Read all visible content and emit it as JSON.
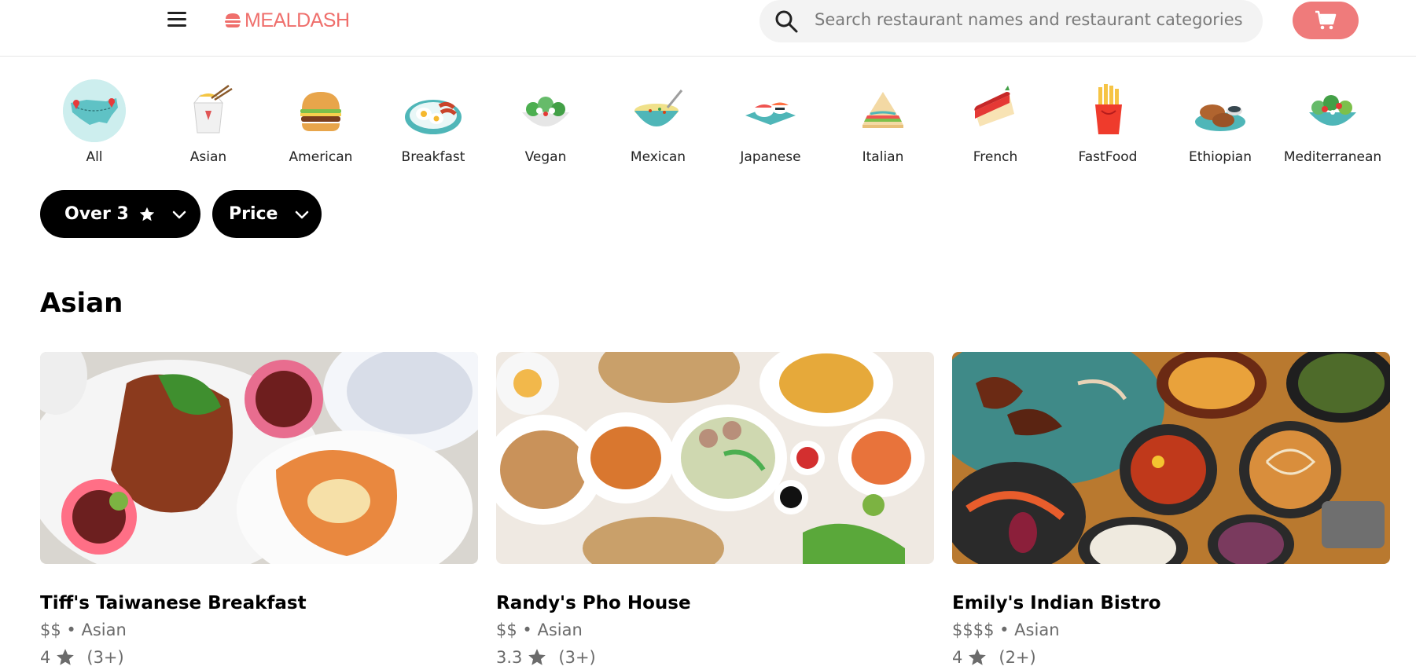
{
  "header": {
    "brand": "MEALDASH",
    "search_placeholder": "Search restaurant names and restaurant categories",
    "accent_color": "#ef6f6c"
  },
  "categories": [
    {
      "label": "All",
      "icon": "usa-map-icon",
      "selected": true
    },
    {
      "label": "Asian",
      "icon": "takeout-box-icon"
    },
    {
      "label": "American",
      "icon": "burger-icon"
    },
    {
      "label": "Breakfast",
      "icon": "eggs-bacon-icon"
    },
    {
      "label": "Vegan",
      "icon": "salad-bowl-icon"
    },
    {
      "label": "Mexican",
      "icon": "soup-bowl-icon"
    },
    {
      "label": "Japanese",
      "icon": "sushi-icon"
    },
    {
      "label": "Italian",
      "icon": "sandwich-icon"
    },
    {
      "label": "French",
      "icon": "cake-icon"
    },
    {
      "label": "FastFood",
      "icon": "fries-icon"
    },
    {
      "label": "Ethiopian",
      "icon": "chicken-leg-icon"
    },
    {
      "label": "Mediterranean",
      "icon": "salad-icon"
    }
  ],
  "filters": {
    "rating_label": "Over 3",
    "price_label": "Price"
  },
  "section": {
    "title": "Asian"
  },
  "restaurants": [
    {
      "name": "Tiff's Taiwanese Breakfast",
      "meta": "$$ • Asian",
      "rating": "4",
      "reviews": "(3+)"
    },
    {
      "name": "Randy's Pho House",
      "meta": "$$ • Asian",
      "rating": "3.3",
      "reviews": "(3+)"
    },
    {
      "name": "Emily's Indian Bistro",
      "meta": "$$$$ • Asian",
      "rating": "4",
      "reviews": "(2+)"
    }
  ]
}
